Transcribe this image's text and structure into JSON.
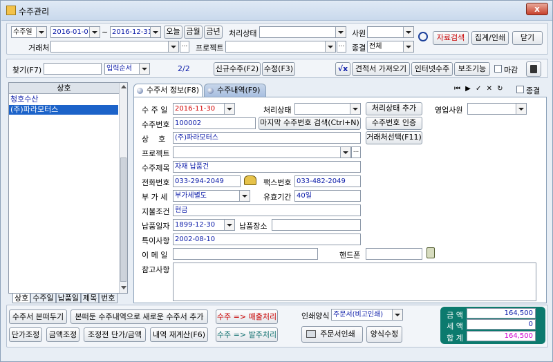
{
  "window": {
    "title": "수주관리",
    "close_glyph": "x"
  },
  "filter": {
    "date_type": "수주일",
    "date_from": "2016-01-01",
    "date_sep": "~",
    "date_to": "2016-12-31",
    "today": "오늘",
    "this_month": "금월",
    "this_year": "금년",
    "status_label": "처리상태",
    "status_value": "",
    "employee_label": "사원",
    "employee_value": "",
    "search_btn": "자료검색",
    "aggregate_btn": "집계/인쇄",
    "close_btn": "닫기",
    "client_label": "거래처",
    "client_value": "",
    "project_label": "프로젝트",
    "project_value": "",
    "closed_label": "종결",
    "closed_value": "전체"
  },
  "find_bar": {
    "find_label": "찾기(F7)",
    "find_value": "",
    "order_value": "입력순서",
    "page_indicator": "2/2",
    "new_btn": "신규수주(F2)",
    "edit_btn": "수정(F3)",
    "calc_icon_label": "√x",
    "quote_btn": "견적서 가져오기",
    "internet_btn": "인터넷수주",
    "report_btn": "보조기능",
    "close_check_label": "마감"
  },
  "list": {
    "header": "상호",
    "items": [
      {
        "name": "청호수산",
        "selected": false
      },
      {
        "name": "(주)파라모터스",
        "selected": true
      }
    ],
    "bottom_tabs": [
      "상호",
      "수주일",
      "납품일",
      "제목",
      "번호"
    ]
  },
  "tabs": {
    "info": "수주서 정보(F8)",
    "details": "수주내역(F9)",
    "closed_label": "종결"
  },
  "form": {
    "order_date_label": "수 주 일",
    "order_date": "2016-11-30",
    "status_label": "처리상태",
    "status_value": "",
    "status_add_btn": "처리상태 추가",
    "sales_label": "영업사원",
    "sales_value": "",
    "order_no_label": "수주번호",
    "order_no": "100002",
    "last_no_btn": "마지막 수주번호 검색(Ctrl+N)",
    "verify_btn": "수주번호 인증",
    "company_label": "상    호",
    "company": "(주)파라모터스",
    "client_select_btn": "거래처선택(F11)",
    "project_label": "프로젝트",
    "project": "",
    "subject_label": "수주제목",
    "subject": "자재 납품건",
    "phone_label": "전화번호",
    "phone": "033-294-2049",
    "fax_label": "팩스번호",
    "fax": "033-482-2049",
    "vat_label": "부 가 세",
    "vat": "부가세별도",
    "validity_label": "유효기간",
    "validity": "40일",
    "payment_label": "지불조건",
    "payment": "현금",
    "delivery_date_label": "납품일자",
    "delivery_date": "1899-12-30",
    "delivery_place_label": "납품장소",
    "delivery_place": "",
    "notes_label": "특이사항",
    "notes": "2002-08-10",
    "email_label": "이 메 일",
    "email": "",
    "mobile_label": "핸드폰",
    "mobile": "",
    "memo_label": "참고사항",
    "memo": ""
  },
  "bottom": {
    "copy_btn": "수주서 본떠두기",
    "copy_new_btn": "본떠둔 수주내역으로 새로운 수주서 추가",
    "to_sales_btn": "수주 => 매출처리",
    "unit_price_btn": "단가조정",
    "amount_btn": "금액조정",
    "pre_adjust_btn": "조정전 단가/금액",
    "recalc_btn": "내역 재계산(F6)",
    "to_order_btn": "수주 => 발주처리",
    "print_format_label": "인쇄양식",
    "print_format_value": "주문서(비고인쇄)",
    "print_btn": "주문서인쇄",
    "format_edit_btn": "양식수정"
  },
  "summary": {
    "amount_label": "금 액",
    "amount": "164,500",
    "tax_label": "세 액",
    "tax": "0",
    "total_label": "합 계",
    "total": "164,500"
  },
  "colors": {
    "accent_blue": "#0a1aa8",
    "selected_row": "#1c63c9",
    "summary_bg": "#0c7a6e",
    "red_text": "#d10000",
    "total_text": "#d000d0"
  }
}
